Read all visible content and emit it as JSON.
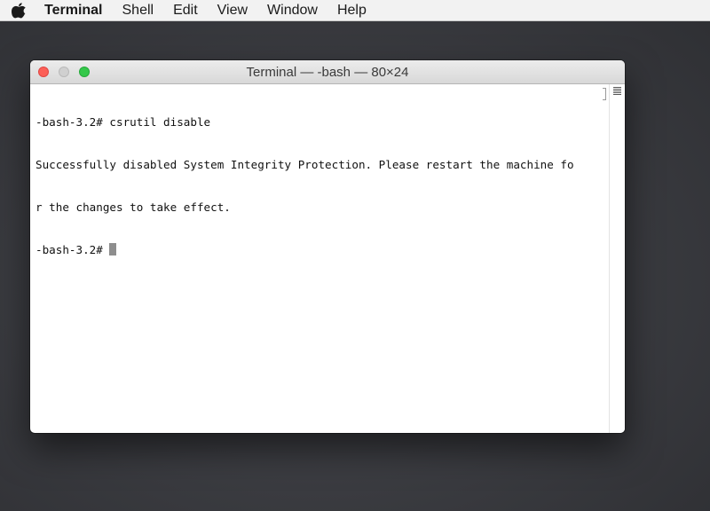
{
  "menubar": {
    "apple_icon": "apple-logo-icon",
    "items": [
      {
        "label": "Terminal"
      },
      {
        "label": "Shell"
      },
      {
        "label": "Edit"
      },
      {
        "label": "View"
      },
      {
        "label": "Window"
      },
      {
        "label": "Help"
      }
    ]
  },
  "window": {
    "title": "Terminal — -bash — 80×24",
    "buttons": {
      "close_color": "#fc5f57",
      "minimize_color": "#d0d0d0",
      "zoom_color": "#34c84a"
    },
    "lines": [
      "-bash-3.2# csrutil disable",
      "Successfully disabled System Integrity Protection. Please restart the machine fo",
      "r the changes to take effect.",
      "-bash-3.2# "
    ],
    "split_icon": "split-pane-icon"
  }
}
